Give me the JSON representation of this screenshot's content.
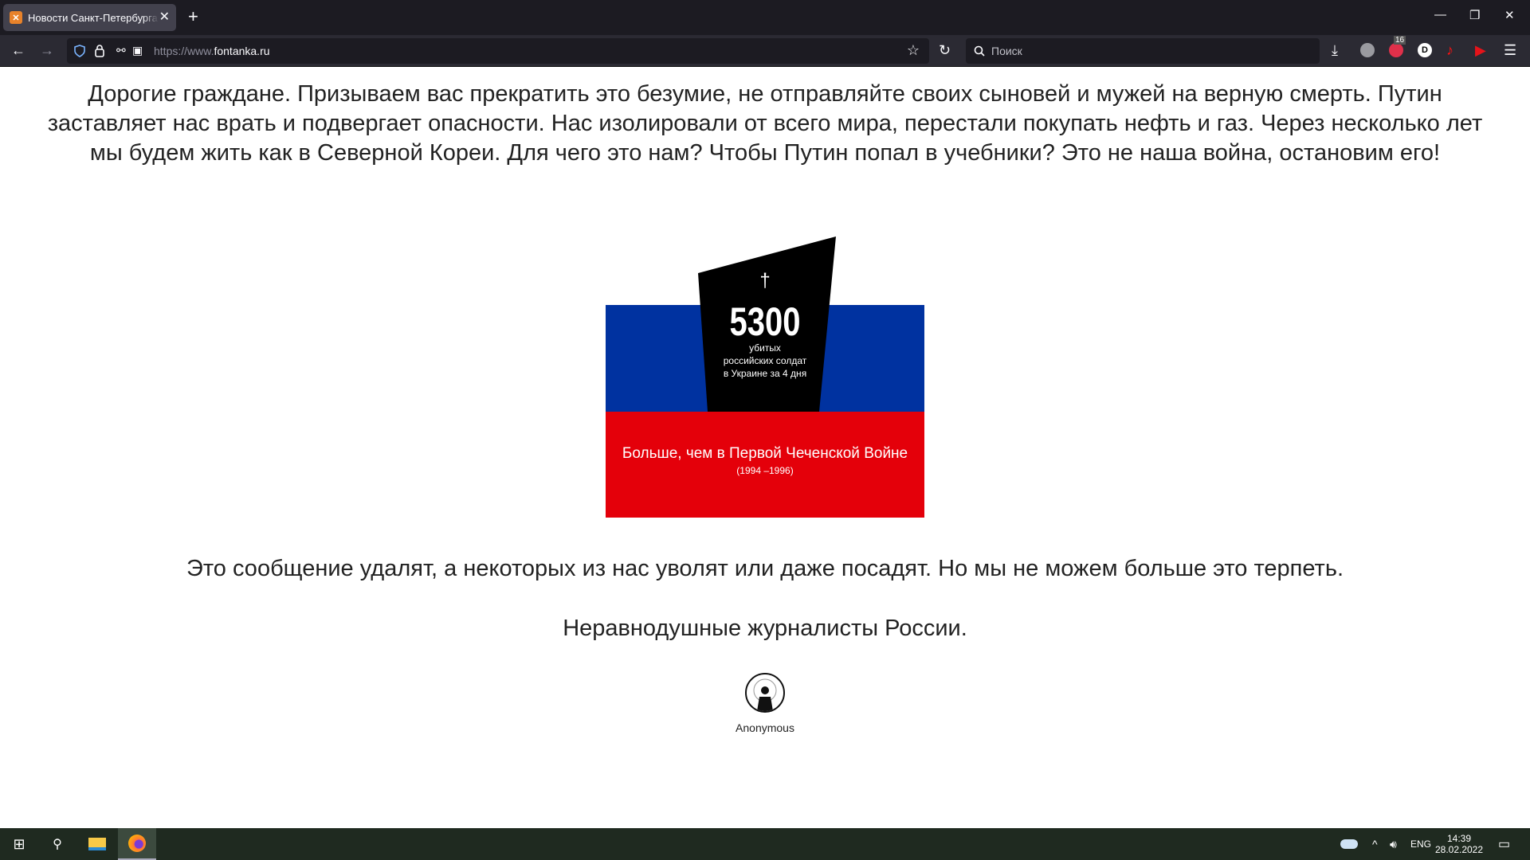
{
  "browser": {
    "tab": {
      "title": "Новости Санкт-Петербурга - Фонтанка.Ру",
      "favicon": "fontanka-icon"
    },
    "url_prefix": "https://www.",
    "url_domain": "fontanka.ru",
    "search_placeholder": "Поиск",
    "ext_badge": "16"
  },
  "page": {
    "paragraph1_lines": [
      "Дорогие граждане. Призываем вас прекратить это безумие, не отправляйте своих сыновей и мужей на верную смерть. Путин",
      "заставляет нас врать и подвергает опасности. Нас изолировали от всего мира, перестали покупать нефть и газ. Через несколько лет",
      "мы будем жить как в Северной Кореи. Для чего это нам? Чтобы Путин попал в учебники? Это не наша война, остановим его!"
    ],
    "infographic": {
      "cross": "†",
      "number": "5300",
      "caption_lines": [
        "убитых",
        "российских солдат",
        "в Украине за 4 дня"
      ],
      "headline": "Больше, чем в Первой Чеченской Войне",
      "years": "(1994 –1996)",
      "colors": {
        "white": "#ffffff",
        "blue": "#0032a0",
        "red": "#e4000a",
        "stone": "#000000"
      }
    },
    "paragraph2": "Это сообщение удалят, а некоторых из нас уволят или даже посадят. Но мы не можем больше это терпеть.",
    "signature": "Неравнодушные журналисты России.",
    "anon_label": "Anonymous"
  },
  "taskbar": {
    "language": "ENG",
    "time": "14:39",
    "date": "28.02.2022"
  }
}
